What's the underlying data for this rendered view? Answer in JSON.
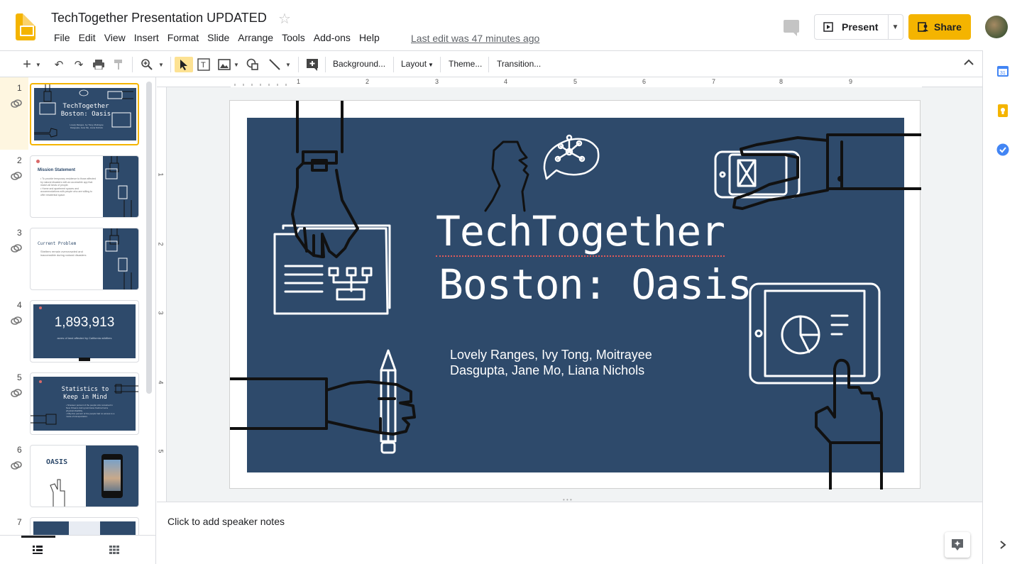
{
  "header": {
    "title": "TechTogether Presentation UPDATED",
    "menu": [
      "File",
      "Edit",
      "View",
      "Insert",
      "Format",
      "Slide",
      "Arrange",
      "Tools",
      "Add-ons",
      "Help"
    ],
    "last_edit": "Last edit was 47 minutes ago",
    "present_label": "Present",
    "share_label": "Share"
  },
  "toolbar": {
    "background_label": "Background...",
    "layout_label": "Layout",
    "theme_label": "Theme...",
    "transition_label": "Transition..."
  },
  "ruler": {
    "top_marks": [
      "1",
      "2",
      "3",
      "4",
      "5",
      "6",
      "7",
      "8",
      "9"
    ],
    "left_marks": [
      "1",
      "2",
      "3",
      "4",
      "5"
    ]
  },
  "slides": [
    {
      "num": "1",
      "title_a": "TechTogether",
      "title_b": "Boston: Oasis"
    },
    {
      "num": "2",
      "title": "Mission Statement"
    },
    {
      "num": "3",
      "title": "Current Problem",
      "body": "Shelters remain overcrowded and inaccessible during natural disasters"
    },
    {
      "num": "4",
      "big": "1,893,913",
      "small": "acres of land affected by California wildfires"
    },
    {
      "num": "5",
      "title_a": "Statistics to",
      "title_b": "Keep in Mind"
    },
    {
      "num": "6",
      "title": "OASIS"
    },
    {
      "num": "7"
    }
  ],
  "main_slide": {
    "title_line1": "TechTogether",
    "title_line2": "Boston: Oasis",
    "subtitle": "Lovely Ranges, Ivy Tong, Moitrayee Dasgupta, Jane Mo, Liana Nichols"
  },
  "notes": {
    "placeholder": "Click to add speaker notes"
  },
  "colors": {
    "accent": "#f4b400",
    "slide_bg": "#2e4a6b"
  }
}
